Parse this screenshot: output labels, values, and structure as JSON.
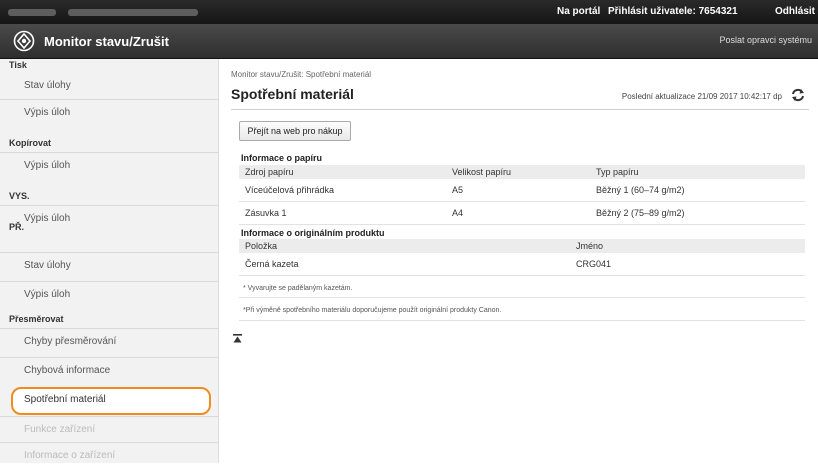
{
  "topbar": {
    "portal": "Na portál",
    "login": "Přihlásit uživatele: 7654321",
    "logout": "Odhlásit"
  },
  "titlebar": {
    "title": "Monitor stavu/Zrušit",
    "support": "Poslat opravci systému"
  },
  "sidebar": {
    "print": {
      "head": "Tisk",
      "items": [
        "Stav úlohy",
        "Výpis úloh"
      ]
    },
    "copy": {
      "head": "Kopírovat",
      "items": [
        "Výpis úloh"
      ]
    },
    "send": {
      "head": "VYS.",
      "items": [
        "Výpis úloh"
      ]
    },
    "receive": {
      "head": "PŘ.",
      "items": [
        "Stav úlohy",
        "Výpis úloh"
      ]
    },
    "forward": {
      "head": "Přesměrovat",
      "items": [
        "Chyby přesměrování"
      ]
    },
    "other": [
      "Chybová informace",
      "Spotřební materiál",
      "Funkce zařízení",
      "Informace o zařízení"
    ]
  },
  "main": {
    "breadcrumb": "Monitor stavu/Zrušit: Spotřební materiál",
    "title": "Spotřební materiál",
    "last_update": "Poslední aktualizace 21/09 2017 10:42:17 dp",
    "buy_button": "Přejít na web pro nákup",
    "paper": {
      "title": "Informace o papíru",
      "headers": [
        "Zdroj papíru",
        "Velikost papíru",
        "Typ papíru"
      ],
      "rows": [
        [
          "Víceúčelová přihrádka",
          "A5",
          "Běžný 1 (60–74 g/m2)"
        ],
        [
          "Zásuvka 1",
          "A4",
          "Běžný 2 (75–89 g/m2)"
        ]
      ]
    },
    "original": {
      "title": "Informace o originálním produktu",
      "headers": [
        "Položka",
        "Jméno"
      ],
      "rows": [
        [
          "Černá kazeta",
          "CRG041"
        ]
      ]
    },
    "note1": "* Vyvarujte se padělaným kazetám.",
    "note2": "*Při výměně spotřebního materiálu doporučujeme použít originální produkty Canon."
  }
}
